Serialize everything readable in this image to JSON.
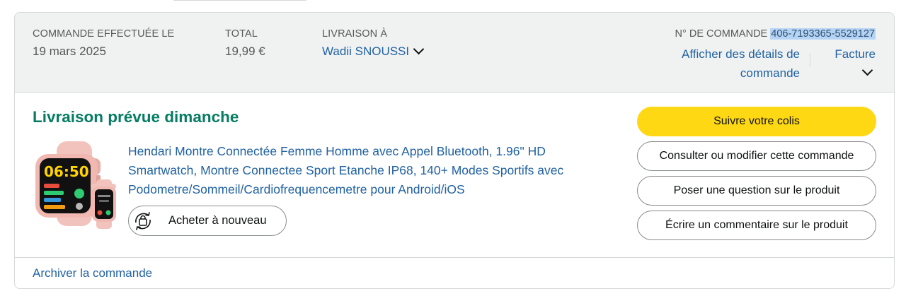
{
  "header": {
    "order_date_label": "COMMANDE EFFECTUÉE LE",
    "order_date_value": "19 mars 2025",
    "total_label": "TOTAL",
    "total_value": "19,99 €",
    "ship_to_label": "LIVRAISON À",
    "ship_to_name": "Wadii SNOUSSI",
    "order_number_label": "N° DE COMMANDE",
    "order_number_value": "406-7193365-5529127",
    "details_link": "Afficher des détails de commande",
    "invoice_link": "Facture"
  },
  "shipment": {
    "status_title": "Livraison prévue dimanche"
  },
  "product": {
    "title": "Hendari Montre Connectée Femme Homme avec Appel Bluetooth, 1.96\" HD Smartwatch, Montre Connectee Sport Etanche IP68, 140+ Modes Sportifs avec Podometre/Sommeil/Cardiofrequencemetre pour Android/iOS",
    "image_time": "06:50",
    "buy_again_label": "Acheter à nouveau"
  },
  "actions": [
    {
      "label": "Suivre votre colis"
    },
    {
      "label": "Consulter ou modifier cette commande"
    },
    {
      "label": "Poser une question sur le produit"
    },
    {
      "label": "Écrire un commentaire sur le produit"
    }
  ],
  "footer": {
    "archive_link": "Archiver la commande"
  },
  "colors": {
    "link": "#2162a1",
    "delivery_title": "#067d62",
    "primary_button": "#ffd814",
    "header_bg": "#f0f2f2"
  },
  "icons": {
    "ship_to_chevron": "chevron-down-icon",
    "invoice_chevron": "chevron-down-icon",
    "buy_again": "reorder-icon"
  }
}
